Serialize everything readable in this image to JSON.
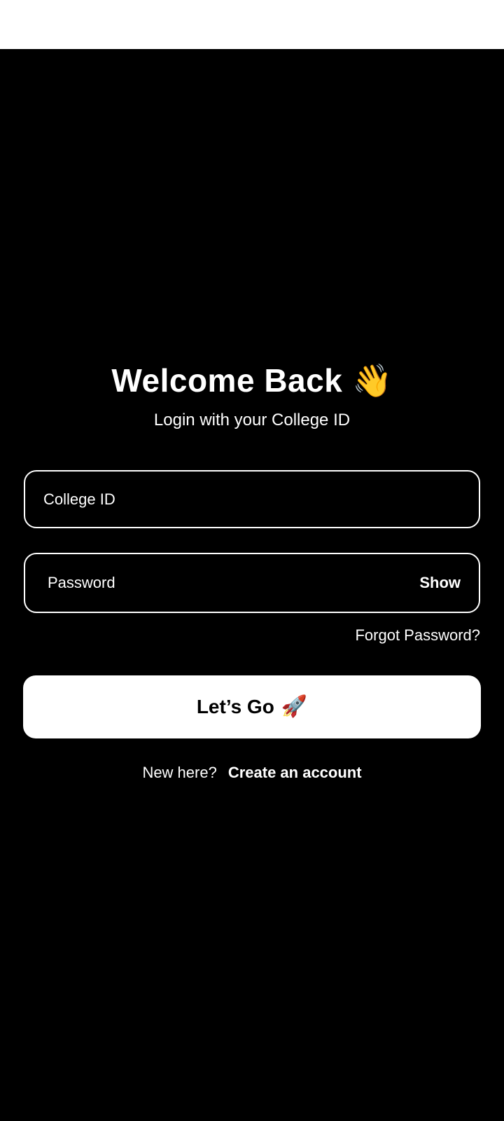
{
  "colors": {
    "background": "#000000",
    "status_bar": "#ffffff",
    "text": "#ffffff",
    "button_bg": "#ffffff",
    "button_text": "#000000"
  },
  "header": {
    "title": "Welcome Back",
    "title_emoji": "👋",
    "subtitle": "Login with your College ID"
  },
  "form": {
    "college_id": {
      "placeholder": "College ID",
      "value": ""
    },
    "password": {
      "placeholder": "Password",
      "value": "",
      "toggle_label": "Show"
    },
    "forgot_label": "Forgot Password?",
    "submit_label": "Let’s Go",
    "submit_emoji": "🚀"
  },
  "footer": {
    "prompt": "New here?",
    "link_label": "Create an account"
  },
  "icons": {
    "title_icon": "waving-hand-icon",
    "button_icon": "rocket-icon"
  }
}
